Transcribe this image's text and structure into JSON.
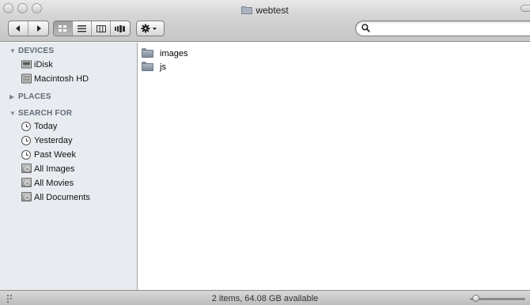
{
  "window": {
    "title": "webtest"
  },
  "toolbar": {
    "nav": [
      "back-icon",
      "forward-icon"
    ],
    "views": [
      "icon-view-icon",
      "list-view-icon",
      "column-view-icon",
      "cover-flow-icon"
    ],
    "active_view": 0,
    "action_icons": [
      "gear-icon",
      "chevron-down-icon"
    ],
    "search": {
      "value": "",
      "placeholder": ""
    }
  },
  "sidebar": {
    "sections": {
      "devices": "DEVICES",
      "places": "PLACES",
      "search_for": "SEARCH FOR"
    },
    "devices": [
      {
        "label": "iDisk",
        "icon": "idisk-icon"
      },
      {
        "label": "Macintosh HD",
        "icon": "hard-drive-icon"
      }
    ],
    "search_for": [
      {
        "label": "Today",
        "icon": "clock-icon"
      },
      {
        "label": "Yesterday",
        "icon": "clock-icon"
      },
      {
        "label": "Past Week",
        "icon": "clock-icon"
      },
      {
        "label": "All Images",
        "icon": "smart-folder-icon"
      },
      {
        "label": "All Movies",
        "icon": "smart-folder-icon"
      },
      {
        "label": "All Documents",
        "icon": "smart-folder-icon"
      }
    ]
  },
  "files": [
    {
      "name": "images",
      "icon": "folder-icon"
    },
    {
      "name": "js",
      "icon": "folder-icon"
    }
  ],
  "status": {
    "text": "2 items, 64.08 GB available",
    "icon_size_level": 0.05
  },
  "colors": {
    "sidebar_bg": "#e8ecf1",
    "section_header": "#616a76",
    "folder": "#8f99a6"
  }
}
